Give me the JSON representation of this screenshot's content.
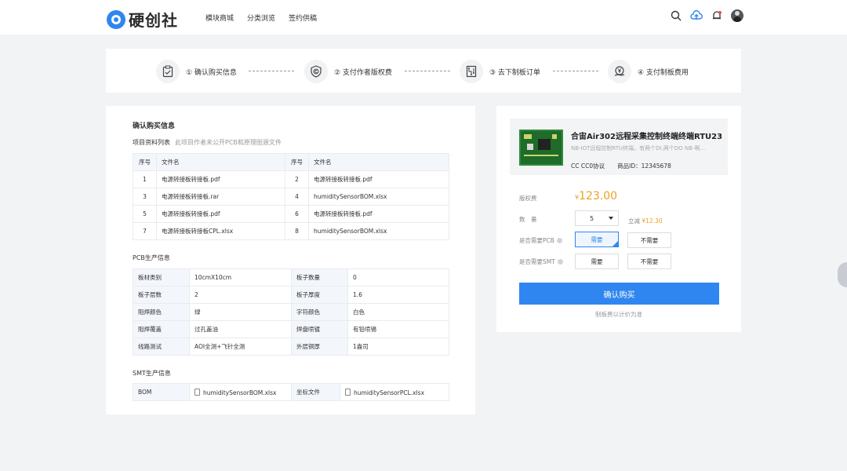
{
  "header": {
    "brand": "硬创社",
    "nav": [
      "模块商城",
      "分类浏览",
      "签约供稿"
    ]
  },
  "steps": [
    {
      "label": "① 确认购买信息",
      "icon": "clipboard-check-icon"
    },
    {
      "label": "② 支付作者版权费",
      "icon": "shield-copyright-icon"
    },
    {
      "label": "③ 去下制板订单",
      "icon": "circuit-board-icon"
    },
    {
      "label": "④ 支付制板费用",
      "icon": "yen-hand-icon"
    }
  ],
  "purchase": {
    "title": "确认购买信息",
    "files_section": "项目资料列表",
    "files_note": "此项目作者未公开PCB和原理图源文件",
    "files_headers": [
      "序号",
      "文件名",
      "序号",
      "文件名"
    ],
    "files": [
      [
        "1",
        "电源转接板转接板.pdf",
        "2",
        "电源转接板转接板.pdf"
      ],
      [
        "3",
        "电源转接板转接板.rar",
        "4",
        "humiditySensorBOM.xlsx"
      ],
      [
        "5",
        "电源转接板转接板.pdf",
        "6",
        "电源转接板转接板.pdf"
      ],
      [
        "7",
        "电源转接板转接板CPL.xlsx",
        "8",
        "humiditySensorBOM.xlsx"
      ]
    ],
    "pcb_section": "PCB生产信息",
    "pcb_rows": [
      [
        "板材类别",
        "10cmX10cm",
        "板子数量",
        "0"
      ],
      [
        "板子层数",
        "2",
        "板子厚度",
        "1.6"
      ],
      [
        "阻焊颜色",
        "绿",
        "字符颜色",
        "白色"
      ],
      [
        "阻焊覆盖",
        "过孔盖油",
        "焊盘喷镀",
        "有铅喷锡"
      ],
      [
        "线路测试",
        "AOI全测+飞针全测",
        "外层铜厚",
        "1盎司"
      ]
    ],
    "smt_section": "SMT生产信息",
    "smt_row": [
      "BOM",
      "humiditySensorBOM.xlsx",
      "坐标文件",
      "humiditySensorPCL.xlsx"
    ]
  },
  "product": {
    "title": "合宙Air302远程采集控制终端终端RTU23",
    "desc": "NB-IOT远程控制RTU终端，有两个DI,两个DO NB-啊...",
    "license": "CC CC0协议",
    "id_label": "商品ID：",
    "id": "12345678",
    "royalty_label": "版权费",
    "price_symbol": "¥",
    "price": "123.00",
    "qty_label": "数　量",
    "qty": "5",
    "save_label": "立减",
    "save_value": "¥12.30",
    "pcb_label": "是否需要PCB",
    "smt_label": "是否需要SMT",
    "need": "需要",
    "not_need": "不需要",
    "buy": "确认购买",
    "buy_note": "制板费以计价为准"
  },
  "colors": {
    "primary": "#2f86f0",
    "price": "#f0a020"
  }
}
